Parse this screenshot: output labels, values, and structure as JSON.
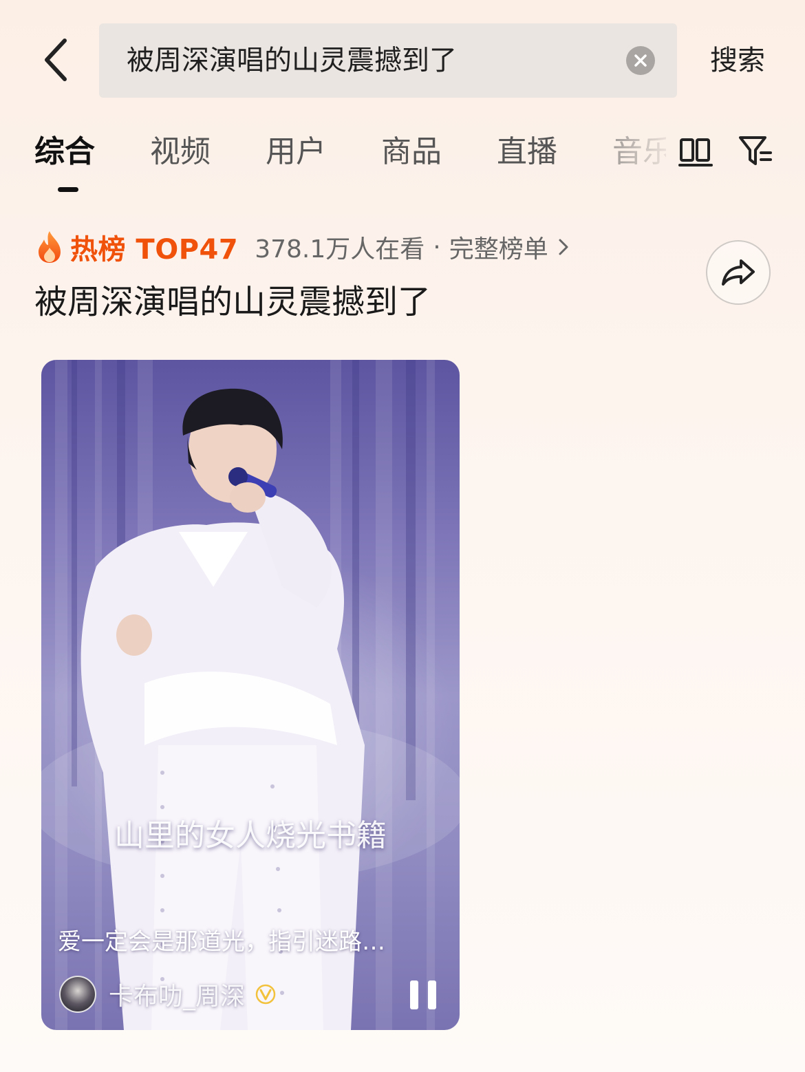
{
  "search": {
    "query": "被周深演唱的山灵震撼到了",
    "action_label": "搜索"
  },
  "tabs": [
    {
      "label": "综合",
      "active": true
    },
    {
      "label": "视频",
      "active": false
    },
    {
      "label": "用户",
      "active": false
    },
    {
      "label": "商品",
      "active": false
    },
    {
      "label": "直播",
      "active": false
    },
    {
      "label": "音乐",
      "active": false
    }
  ],
  "hot": {
    "label": "热榜 TOP47",
    "viewers": "378.1万人在看",
    "separator": "·",
    "link_label": "完整榜单",
    "title": "被周深演唱的山灵震撼到了",
    "accent_color": "#f0520c"
  },
  "video": {
    "lyric": "山里的女人烧光书籍",
    "caption": "爱一定会是那道光，指引迷路…",
    "author": "卡布叻_周深",
    "verified_icon": "verified-v-icon",
    "state": "playing"
  },
  "icons": {
    "back": "chevron-left-icon",
    "clear": "clear-icon",
    "dual_view": "dual-column-icon",
    "filter": "filter-icon",
    "flame": "flame-icon",
    "share": "share-icon",
    "pause": "pause-icon"
  }
}
